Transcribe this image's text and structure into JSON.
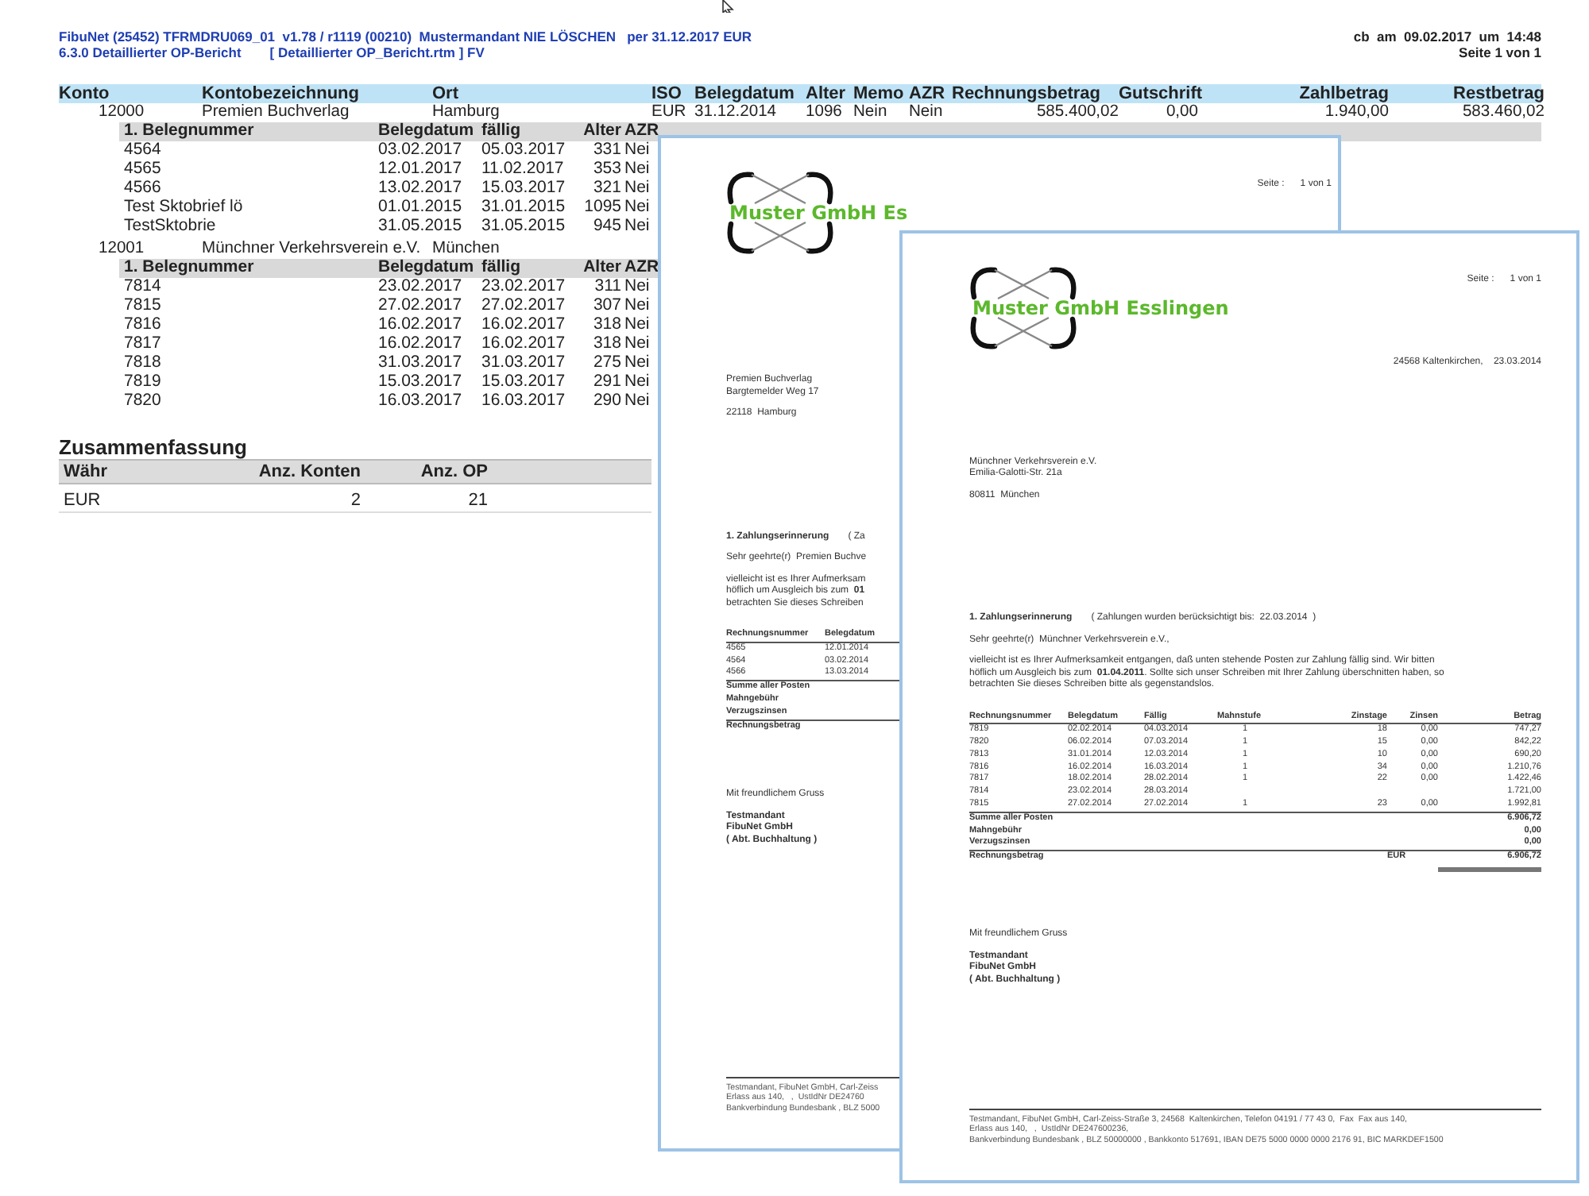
{
  "report_header": {
    "title": "FibuNet (25452) TFRMDRU069_01  v1.78 / r1119 (00210)  Mustermandant NIE LÖSCHEN   per 31.12.2017 EUR",
    "report_name": "6.3.0 Detaillierter OP-Bericht",
    "template": "[ Detaillierter OP_Bericht.rtm ] FV",
    "printed": "cb  am  09.02.2017  um  14:48",
    "page": "Seite 1 von 1"
  },
  "main_table": {
    "columns": [
      "Konto",
      "Kontobezeichnung",
      "Ort",
      "ISO",
      "Belegdatum",
      "Alter",
      "Memo",
      "AZR",
      "Rechnungsbetrag",
      "Gutschrift",
      "Zahlbetrag",
      "Restbetrag"
    ],
    "accounts": [
      {
        "cells": [
          "12000",
          "Premien Buchverlag",
          "Hamburg",
          "EUR",
          "31.12.2014",
          "1096",
          "Nein",
          "Nein",
          "585.400,02",
          "0,00",
          "1.940,00",
          "583.460,02"
        ],
        "subheader": [
          "1. Belegnummer",
          "Belegdatum",
          "fällig",
          "Alter",
          "AZR"
        ],
        "items": [
          {
            "cells": [
              "4564",
              "03.02.2017",
              "05.03.2017",
              "331",
              "Nei"
            ]
          },
          {
            "cells": [
              "4565",
              "12.01.2017",
              "11.02.2017",
              "353",
              "Nei"
            ]
          },
          {
            "cells": [
              "4566",
              "13.02.2017",
              "15.03.2017",
              "321",
              "Nei"
            ]
          },
          {
            "cells": [
              "Test Sktobrief lö",
              "01.01.2015",
              "31.01.2015",
              "1095",
              "Nei"
            ]
          },
          {
            "cells": [
              "TestSktobrie",
              "31.05.2015",
              "31.05.2015",
              "945",
              "Nei"
            ]
          }
        ]
      },
      {
        "cells": [
          "12001",
          "Münchner Verkehrsverein e.V.",
          "München"
        ],
        "subheader": [
          "1. Belegnummer",
          "Belegdatum",
          "fällig",
          "Alter",
          "AZR"
        ],
        "items": [
          {
            "cells": [
              "7814",
              "23.02.2017",
              "23.02.2017",
              "311",
              "Nei"
            ]
          },
          {
            "cells": [
              "7815",
              "27.02.2017",
              "27.02.2017",
              "307",
              "Nei"
            ]
          },
          {
            "cells": [
              "7816",
              "16.02.2017",
              "16.02.2017",
              "318",
              "Nei"
            ]
          },
          {
            "cells": [
              "7817",
              "16.02.2017",
              "16.02.2017",
              "318",
              "Nei"
            ]
          },
          {
            "cells": [
              "7818",
              "31.03.2017",
              "31.03.2017",
              "275",
              "Nei"
            ]
          },
          {
            "cells": [
              "7819",
              "15.03.2017",
              "15.03.2017",
              "291",
              "Nei"
            ]
          },
          {
            "cells": [
              "7820",
              "16.03.2017",
              "16.03.2017",
              "290",
              "Nei"
            ]
          }
        ]
      }
    ]
  },
  "summary": {
    "title": "Zusammenfassung",
    "columns": [
      "Währ",
      "Anz. Konten",
      "Anz. OP"
    ],
    "rows": [
      {
        "cells": [
          "EUR",
          "2",
          "21"
        ]
      }
    ]
  },
  "letters": [
    {
      "page_label": "Seite :",
      "page_value": "1 von 1",
      "company": "Muster GmbH Es",
      "address_lines": [
        "Premien Buchverlag",
        "Bargtemelder Weg 17"
      ],
      "city": "22118  Hamburg",
      "subject": "1. Zahlungserinnerung",
      "subject_note": "( Za",
      "salutation": "Sehr geehrte(r)  Premien Buchve",
      "paragraph_lines": [
        "vielleicht ist es Ihrer Aufmerksam",
        "höflich um Ausgleich bis zum  **01**",
        "betrachten Sie dieses Schreiben"
      ],
      "table": {
        "columns": [
          "Rechnungsnummer",
          "Belegdatum"
        ],
        "rows": [
          {
            "cells": [
              "4565",
              "12.01.2014"
            ]
          },
          {
            "cells": [
              "4564",
              "03.02.2014"
            ]
          },
          {
            "cells": [
              "4566",
              "13.03.2014"
            ]
          }
        ],
        "totals": [
          {
            "label": "Summe aller Posten",
            "total": false
          },
          {
            "label": "Mahngebühr",
            "total": false
          },
          {
            "label": "Verzugszinsen",
            "total": false
          },
          {
            "label": "Rechnungsbetrag",
            "total": true
          }
        ]
      },
      "closing": "Mit freundlichem Gruss",
      "signature_lines": [
        "Testmandant",
        "FibuNet GmbH",
        "( Abt. Buchhaltung )"
      ],
      "footer_lines": [
        "Testmandant, FibuNet GmbH, Carl-Zeiss",
        "Erlass aus 140,   ,  UstIdNr DE24760",
        "Bankverbindung Bundesbank , BLZ 5000"
      ]
    },
    {
      "page_label": "Seite :",
      "page_value": "1 von 1",
      "company": "Muster GmbH Esslingen",
      "place_date": "24568 Kaltenkirchen,    23.03.2014",
      "address_lines": [
        "Münchner Verkehrsverein e.V.",
        "Emilia-Galotti-Str. 21a"
      ],
      "city": "80811  München",
      "subject": "1. Zahlungserinnerung",
      "subject_note": "( Zahlungen wurden berücksichtigt bis:  22.03.2014  )",
      "salutation": "Sehr geehrte(r)  Münchner Verkehrsverein e.V.,",
      "paragraph_lines": [
        "vielleicht ist es Ihrer Aufmerksamkeit entgangen, daß unten stehende Posten zur Zahlung fällig sind. Wir bitten",
        "höflich um Ausgleich bis zum  **01.04.2011**. Sollte sich unser Schreiben mit Ihrer Zahlung überschnitten haben, so",
        "betrachten Sie dieses Schreiben bitte als gegenstandslos."
      ],
      "table": {
        "columns": [
          "Rechnungsnummer",
          "Belegdatum",
          "Fällig",
          "Mahnstufe",
          "Zinstage",
          "Zinsen",
          "Betrag"
        ],
        "rows": [
          {
            "cells": [
              "7819",
              "02.02.2014",
              "04.03.2014",
              "1",
              "18",
              "0,00"
            ],
            "amount": "747,27"
          },
          {
            "cells": [
              "7820",
              "06.02.2014",
              "07.03.2014",
              "1",
              "15",
              "0,00"
            ],
            "amount": "842,22"
          },
          {
            "cells": [
              "7813",
              "31.01.2014",
              "12.03.2014",
              "1",
              "10",
              "0,00"
            ],
            "amount": "690,20"
          },
          {
            "cells": [
              "7816",
              "16.02.2014",
              "16.03.2014",
              "1",
              "34",
              "0,00"
            ],
            "amount": "1.210,76"
          },
          {
            "cells": [
              "7817",
              "18.02.2014",
              "28.02.2014",
              "1",
              "22",
              "0,00"
            ],
            "amount": "1.422,46"
          },
          {
            "cells": [
              "7814",
              "23.02.2014",
              "28.03.2014"
            ],
            "amount": "1.721,00"
          },
          {
            "cells": [
              "7815",
              "27.02.2014",
              "27.02.2014",
              "1",
              "23",
              "0,00"
            ],
            "amount": "1.992,81"
          }
        ],
        "totals": [
          {
            "label": "Summe aller Posten",
            "amount": "6.906,72",
            "total": false
          },
          {
            "label": "Mahngebühr",
            "amount": "0,00",
            "total": false
          },
          {
            "label": "Verzugszinsen",
            "amount": "0,00",
            "total": false
          },
          {
            "label": "Rechnungsbetrag",
            "currency": "EUR",
            "amount": "6.906,72",
            "total": true
          }
        ]
      },
      "closing": "Mit freundlichem Gruss",
      "signature_lines": [
        "Testmandant",
        "FibuNet GmbH",
        "( Abt. Buchhaltung )"
      ],
      "footer_lines": [
        "Testmandant, FibuNet GmbH, Carl-Zeiss-Straße 3, 24568  Kaltenkirchen, Telefon 04191 / 77 43 0,  Fax  Fax aus 140,",
        "Erlass aus 140,   ,  UstIdNr DE247600236,",
        "Bankverbindung Bundesbank , BLZ 50000000 , Bankkonto 517691, IBAN DE75 5000 0000 0000 2176 91, BIC MARKDEF1500"
      ]
    }
  ]
}
